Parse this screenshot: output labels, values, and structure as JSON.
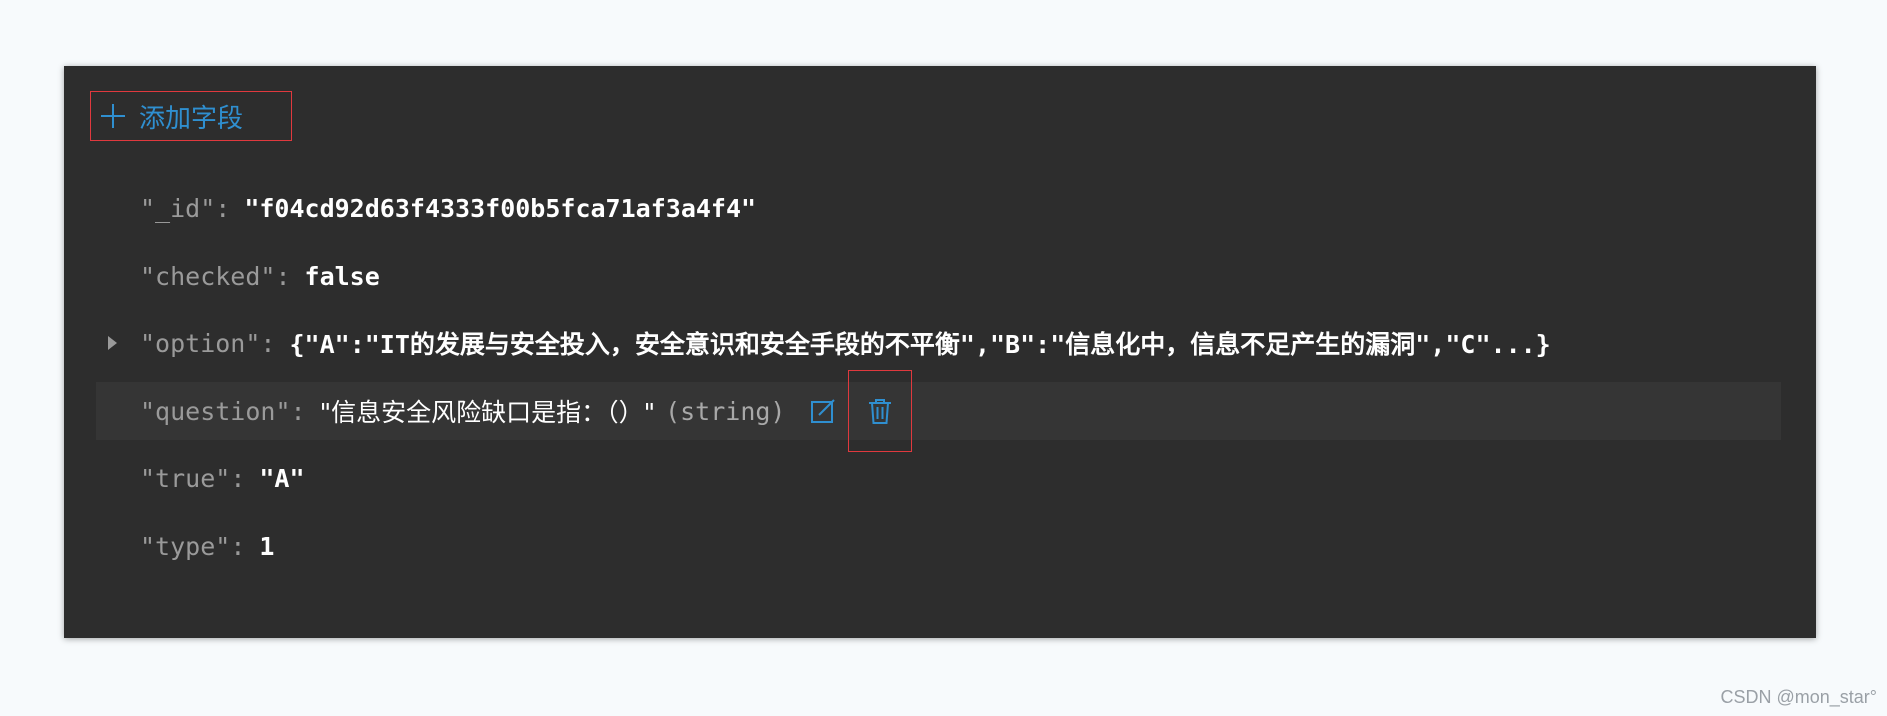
{
  "toolbar": {
    "add_field_label": "添加字段"
  },
  "fields": [
    {
      "key": "\"_id\"",
      "value": "\"f04cd92d63f4333f00b5fca71af3a4f4\""
    },
    {
      "key": "\"checked\"",
      "value": "false"
    },
    {
      "key": "\"option\"",
      "value": "{\"A\":\"IT的发展与安全投入，安全意识和安全手段的不平衡\",\"B\":\"信息化中，信息不足产生的漏洞\",\"C\"...}"
    },
    {
      "key": "\"question\"",
      "value": "\"信息安全风险缺口是指：（）\"",
      "type_hint": "(string)"
    },
    {
      "key": "\"true\"",
      "value": "\"A\""
    },
    {
      "key": "\"type\"",
      "value": "1"
    }
  ],
  "colon": ":",
  "colors": {
    "panel_bg": "#2d2d2d",
    "accent": "#2f8fd0",
    "highlight_border": "#e0393e",
    "key_text": "#9a9a9a",
    "value_text": "#ffffff"
  },
  "icons": {
    "add": "plus-icon",
    "expand": "caret-right-icon",
    "edit": "edit-icon",
    "delete": "trash-icon"
  },
  "watermark": "CSDN @mon_star°"
}
